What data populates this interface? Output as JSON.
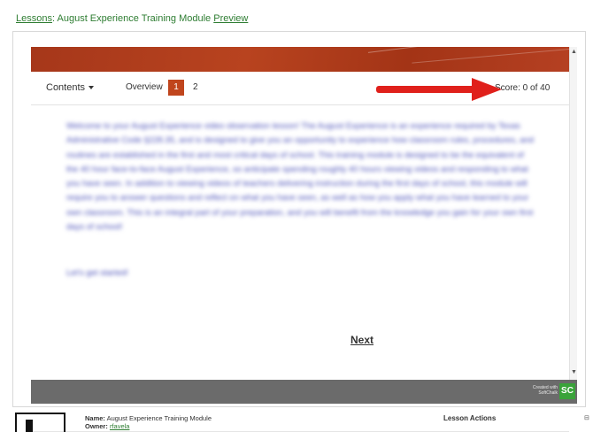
{
  "breadcrumb": {
    "lessons_label": "Lessons",
    "separator": ":",
    "module_title": "August Experience Training Module",
    "preview_label": "Preview"
  },
  "player": {
    "navbar": {
      "contents_label": "Contents",
      "overview_label": "Overview",
      "pages": [
        "1",
        "2"
      ],
      "active_page": "1",
      "score_text": "Score: 0 of 40"
    },
    "content": {
      "intro_paragraph": "Welcome to your August Experience video observation lesson! The August Experience is an experience required by Texas Administrative Code §228.35, and is designed to give you an opportunity to experience how classroom rules, procedures, and routines are established in the first and most critical days of school. This training module is designed to be the equivalent of the 40 hour face-to-face August Experience, so anticipate spending roughly 40 hours viewing videos and responding to what you have seen. In addition to viewing videos of teachers delivering instruction during the first days of school, this module will require you to answer questions and reflect on what you have seen, as well as how you apply what you have learned to your own classroom. This is an integral part of your preparation, and you will benefit from the knowledge you gain for your own first days of school!",
      "closing_line": "Let's get started!",
      "next_label": "Next"
    },
    "footer": {
      "credit_text": "Created with SoftChalk",
      "logo_text": "SC"
    }
  },
  "bottom_panel": {
    "name_label": "Name:",
    "name_value": "August Experience Training Module",
    "owner_label": "Owner:",
    "owner_value": "rfavela",
    "lesson_actions_label": "Lesson Actions"
  },
  "colors": {
    "link_green": "#2e7d32",
    "banner_rust": "#a6371a",
    "active_page": "#c0451d",
    "footer_gray": "#6b6b6b",
    "arrow_red": "#e0201b",
    "blur_text_blue": "#4a50b8"
  }
}
